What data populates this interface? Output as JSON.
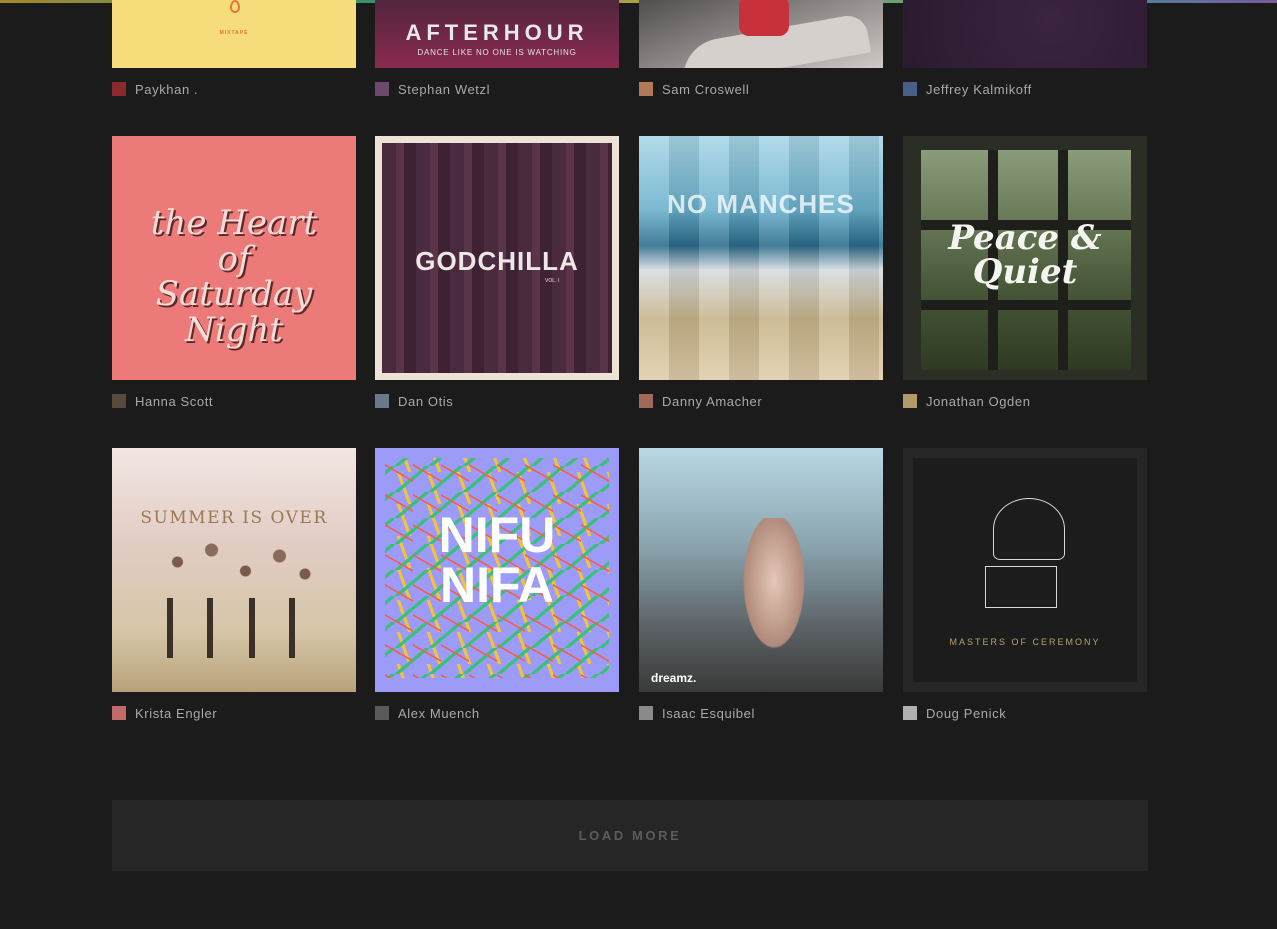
{
  "row1": [
    {
      "author": "Paykhan .",
      "art_text": "",
      "art_sub": "MIXTAPE",
      "bg": "#f6dc7a",
      "avatar_color": "#8a2a2a"
    },
    {
      "author": "Stephan Wetzl",
      "art_text": "AFTERHOUR",
      "art_sub": "DANCE LIKE NO ONE IS WATCHING",
      "bg": "#4a2a3c",
      "avatar_color": "#6b4a6e"
    },
    {
      "author": "Sam Croswell",
      "art_text": "",
      "art_sub": "",
      "bg": "#5a5656",
      "avatar_color": "#b07a5a"
    },
    {
      "author": "Jeffrey Kalmikoff",
      "art_text": "",
      "art_sub": "",
      "bg": "#2a1a2e",
      "avatar_color": "#4a5e8a"
    }
  ],
  "row2": [
    {
      "author": "Hanna Scott",
      "art_text": "the Heart of Saturday Night",
      "art_sub": "",
      "bg": "#ec7a79",
      "avatar_color": "#5a4a3a"
    },
    {
      "author": "Dan Otis",
      "art_text": "GODCHILLA",
      "art_sub": "VOL. I",
      "bg": "#4a2a3e",
      "avatar_color": "#6a7a8a"
    },
    {
      "author": "Danny Amacher",
      "art_text": "NO MANCHES",
      "art_sub": "",
      "bg": "#7ab0c8",
      "avatar_color": "#a06a5a"
    },
    {
      "author": "Jonathan Ogden",
      "art_text": "Peace & Quiet",
      "art_sub": "",
      "bg": "#2e3a2a",
      "avatar_color": "#b09a6a"
    }
  ],
  "row3": [
    {
      "author": "Krista Engler",
      "art_text": "SUMMER IS OVER",
      "art_sub": "",
      "bg": "#e4d0c0",
      "avatar_color": "#c06a6a"
    },
    {
      "author": "Alex Muench",
      "art_text": "NIFU NIFA",
      "art_sub": "",
      "bg": "#9c9cf8",
      "avatar_color": "#5a5a5a"
    },
    {
      "author": "Isaac Esquibel",
      "art_text": "",
      "art_sub": "dreamz.",
      "bg": "#7a8a94",
      "avatar_color": "#8a8a8a"
    },
    {
      "author": "Doug Penick",
      "art_text": "",
      "art_sub": "MASTERS OF CEREMONY",
      "bg": "#1e1e1e",
      "avatar_color": "#b0b0b0"
    }
  ],
  "load_more_label": "LOAD MORE"
}
